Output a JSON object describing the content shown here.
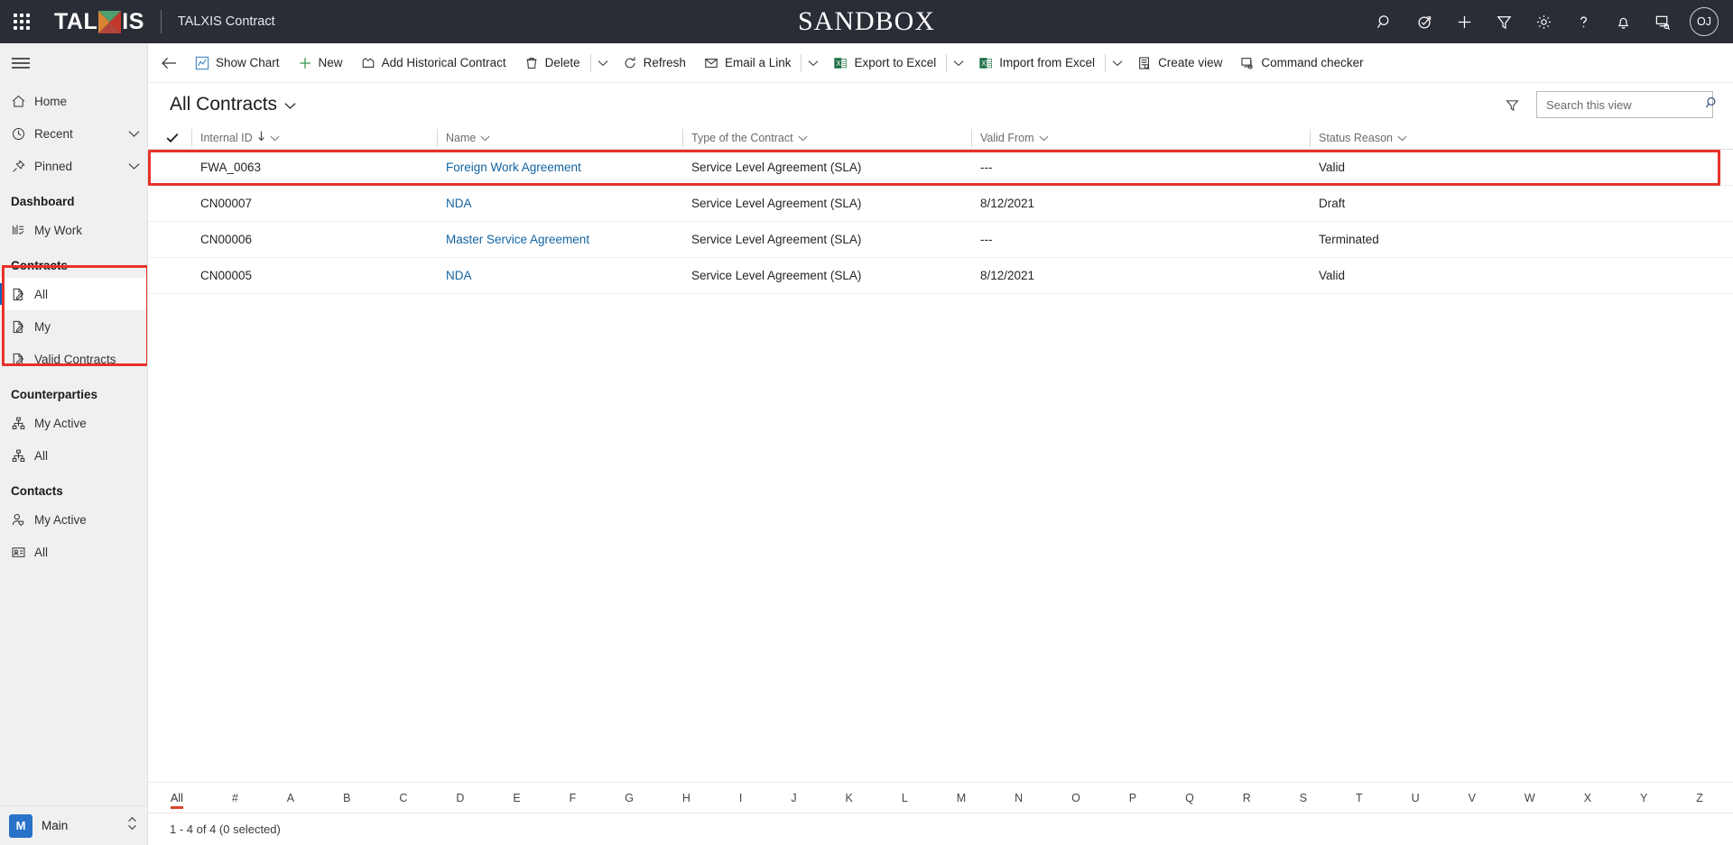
{
  "header": {
    "waffle_label": "app-launcher",
    "brand_text_1": "TAL",
    "brand_text_2": "IS",
    "app_name": "TALXIS Contract",
    "environment_banner": "SANDBOX",
    "avatar_initials": "OJ",
    "icons": [
      {
        "name": "search-icon",
        "title": "Search"
      },
      {
        "name": "diagnostics-icon",
        "title": "Diagnostics"
      },
      {
        "name": "quick-create-icon",
        "title": "New"
      },
      {
        "name": "filter-icon",
        "title": "Filter"
      },
      {
        "name": "settings-gear-icon",
        "title": "Settings"
      },
      {
        "name": "help-icon",
        "title": "Help"
      },
      {
        "name": "notifications-bell-icon",
        "title": "Notifications"
      },
      {
        "name": "feedback-icon",
        "title": "Feedback"
      }
    ]
  },
  "sidebar": {
    "hamburger_label": "Expand navigation",
    "top_items": [
      {
        "label": "Home",
        "icon": "home-icon",
        "chevron": false
      },
      {
        "label": "Recent",
        "icon": "clock-icon",
        "chevron": true
      },
      {
        "label": "Pinned",
        "icon": "pin-icon",
        "chevron": true
      }
    ],
    "groups": [
      {
        "title": "Dashboard",
        "items": [
          {
            "label": "My Work",
            "icon": "dashboard-icon",
            "selected": false
          }
        ]
      },
      {
        "title": "Contracts",
        "highlighted": true,
        "items": [
          {
            "label": "All",
            "icon": "contract-icon",
            "selected": true
          },
          {
            "label": "My",
            "icon": "contract-icon",
            "selected": false
          },
          {
            "label": "Valid Contracts",
            "icon": "contract-icon",
            "selected": false
          }
        ]
      },
      {
        "title": "Counterparties",
        "items": [
          {
            "label": "My Active",
            "icon": "org-icon",
            "selected": false
          },
          {
            "label": "All",
            "icon": "org-icon",
            "selected": false
          }
        ]
      },
      {
        "title": "Contacts",
        "items": [
          {
            "label": "My Active",
            "icon": "person-icon",
            "selected": false
          },
          {
            "label": "All",
            "icon": "contact-card-icon",
            "selected": false
          }
        ]
      }
    ],
    "footer": {
      "badge": "M",
      "area_label": "Main",
      "switcher_icon": "up-down-chevron-icon"
    }
  },
  "commandbar": {
    "back_label": "back-arrow-icon",
    "commands": [
      {
        "label": "Show Chart",
        "icon": "chart-icon",
        "split": false
      },
      {
        "label": "New",
        "icon": "plus-icon",
        "split": false
      },
      {
        "label": "Add Historical Contract",
        "icon": "historical-contract-icon",
        "split": false
      },
      {
        "label": "Delete",
        "icon": "trash-icon",
        "split": true
      },
      {
        "label": "Refresh",
        "icon": "refresh-icon",
        "split": false
      },
      {
        "label": "Email a Link",
        "icon": "email-link-icon",
        "split": true
      },
      {
        "label": "Export to Excel",
        "icon": "excel-icon",
        "split": true
      },
      {
        "label": "Import from Excel",
        "icon": "excel-icon",
        "split": true
      },
      {
        "label": "Create view",
        "icon": "create-view-icon",
        "split": false
      },
      {
        "label": "Command checker",
        "icon": "command-checker-icon",
        "split": false
      }
    ]
  },
  "view": {
    "title": "All Contracts",
    "title_chevron": "chevron-down-icon",
    "filter_icon": "filter-icon",
    "search_placeholder": "Search this view",
    "search_value": "",
    "search_icon": "search-icon"
  },
  "grid": {
    "select_all_icon": "checkmark-icon",
    "columns": [
      {
        "label": "Internal ID",
        "sorted": true,
        "sort_dir": "desc",
        "width_class": "c1"
      },
      {
        "label": "Name",
        "sorted": false,
        "width_class": "c2"
      },
      {
        "label": "Type of the Contract",
        "sorted": false,
        "width_class": "c3"
      },
      {
        "label": "Valid From",
        "sorted": false,
        "width_class": "c4"
      },
      {
        "label": "Status Reason",
        "sorted": false,
        "width_class": "c5"
      }
    ],
    "rows": [
      {
        "internal_id": "FWA_0063",
        "name": "Foreign Work Agreement",
        "type": "Service Level Agreement (SLA)",
        "valid_from": "---",
        "status_reason": "Valid",
        "highlighted": true
      },
      {
        "internal_id": "CN00007",
        "name": "NDA",
        "type": "Service Level Agreement (SLA)",
        "valid_from": "8/12/2021",
        "status_reason": "Draft",
        "highlighted": false
      },
      {
        "internal_id": "CN00006",
        "name": "Master Service Agreement",
        "type": "Service Level Agreement (SLA)",
        "valid_from": "---",
        "status_reason": "Terminated",
        "highlighted": false
      },
      {
        "internal_id": "CN00005",
        "name": "NDA",
        "type": "Service Level Agreement (SLA)",
        "valid_from": "8/12/2021",
        "status_reason": "Valid",
        "highlighted": false
      }
    ]
  },
  "alpha_index": {
    "items": [
      "All",
      "#",
      "A",
      "B",
      "C",
      "D",
      "E",
      "F",
      "G",
      "H",
      "I",
      "J",
      "K",
      "L",
      "M",
      "N",
      "O",
      "P",
      "Q",
      "R",
      "S",
      "T",
      "U",
      "V",
      "W",
      "X",
      "Y",
      "Z"
    ],
    "active": "All"
  },
  "status": {
    "record_count_text": "1 - 4 of 4 (0 selected)"
  },
  "colors": {
    "header_bg": "#2b2d36",
    "accent_blue": "#1264a3",
    "highlight_red": "#e8322a",
    "selected_indicator": "#1760b5",
    "alpha_active": "#d9472b",
    "area_badge": "#2872c8"
  }
}
